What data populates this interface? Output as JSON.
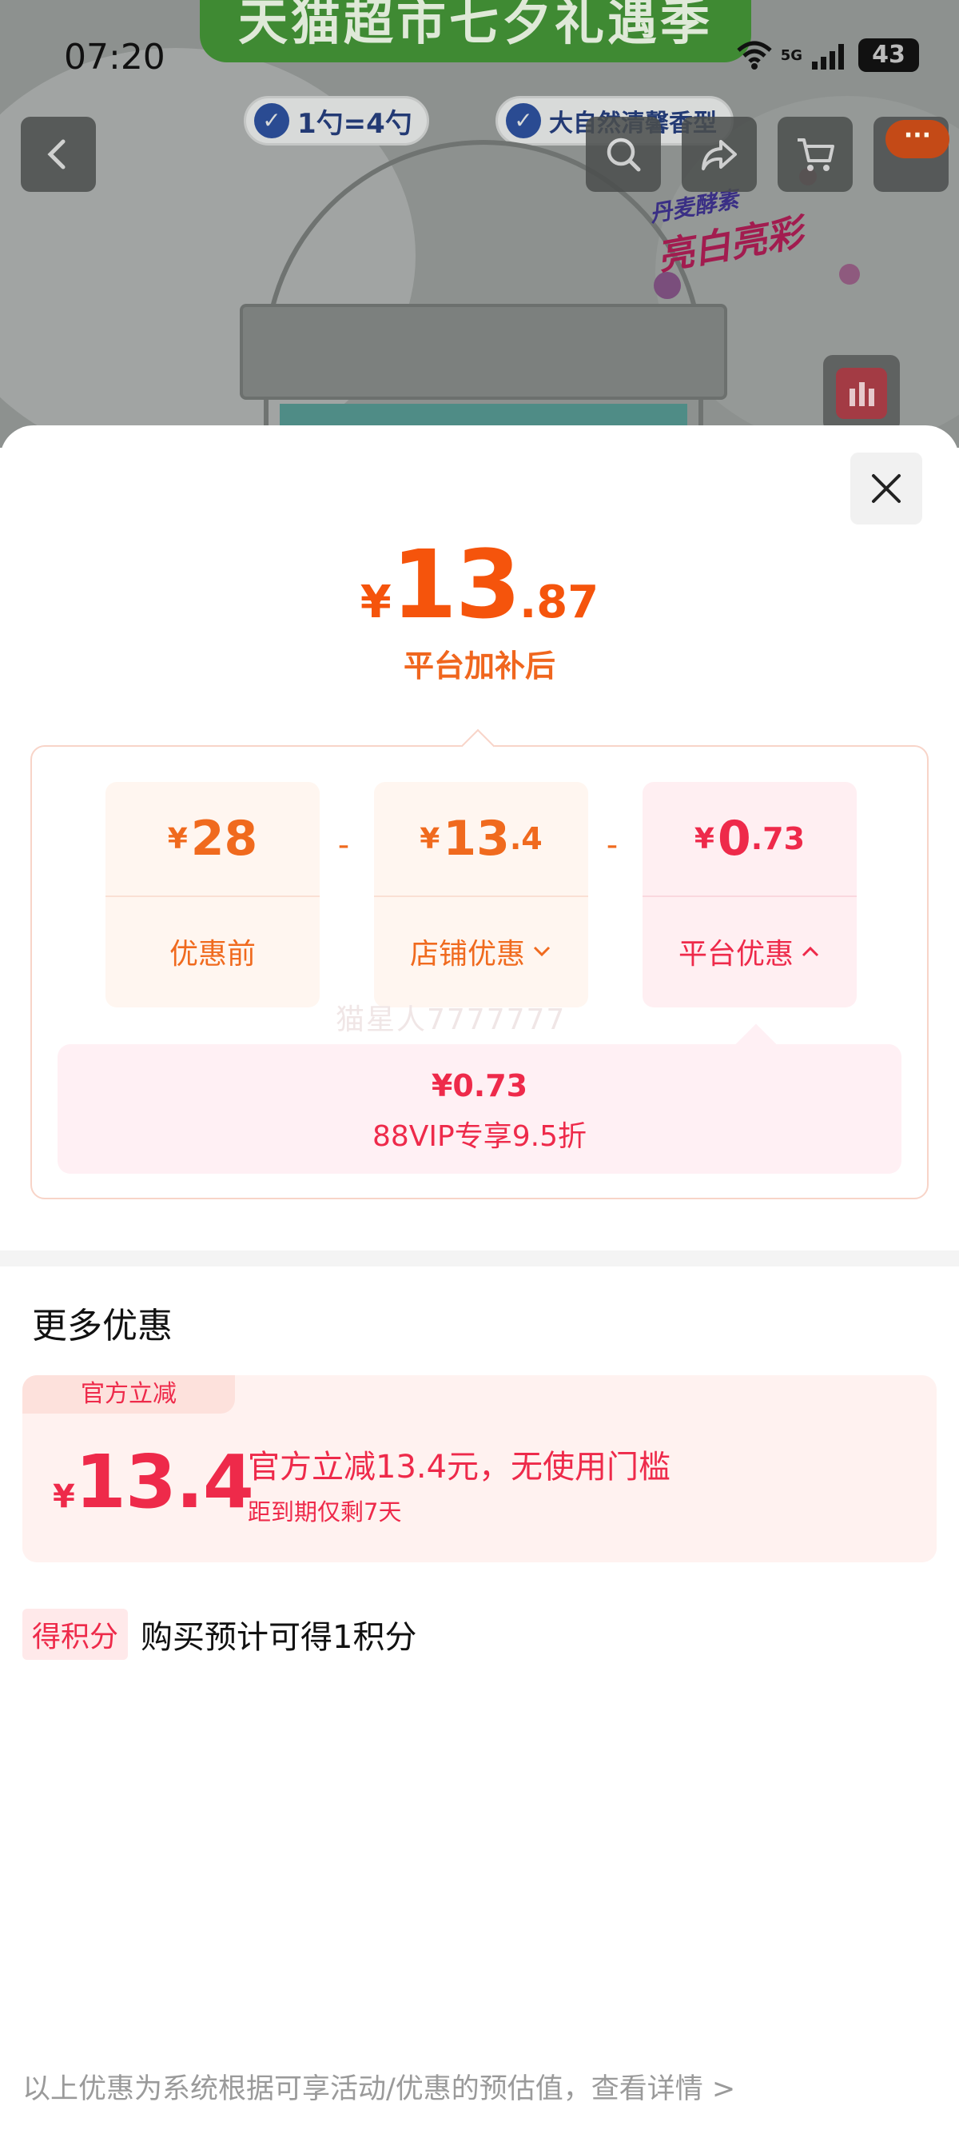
{
  "status_bar": {
    "time": "07:20",
    "network": "5G",
    "battery": "43"
  },
  "product_image": {
    "banner_text": "天猫超市七夕礼遇季",
    "chip_1": "1勺=4勺",
    "chip_2": "大自然清馨香型",
    "promo_line_1": "丹麦酵素",
    "promo_line_2": "亮白亮彩"
  },
  "nav": {
    "back_icon": "chevron-left-icon",
    "search_icon": "search-icon",
    "share_icon": "share-icon",
    "cart_icon": "cart-icon",
    "more_label": "···"
  },
  "sheet": {
    "final_price": {
      "currency": "¥",
      "integer": "13",
      "decimal": ".87",
      "caption": "平台加补后"
    },
    "breakdown": [
      {
        "currency": "¥",
        "integer": "28",
        "decimal": "",
        "label": "优惠前",
        "arrow": ""
      },
      {
        "currency": "¥",
        "integer": "13",
        "decimal": ".4",
        "label": "店铺优惠",
        "arrow": "down"
      },
      {
        "currency": "¥",
        "integer": "0",
        "decimal": ".73",
        "label": "平台优惠",
        "arrow": "up"
      }
    ],
    "operator": "-",
    "watermark": "猫星人7777777",
    "vip": {
      "amount": "¥0.73",
      "description": "88VIP专享9.5折"
    },
    "more_title": "更多优惠",
    "coupon": {
      "tag": "官方立减",
      "currency": "¥",
      "amount": "13.4",
      "description": "官方立减13.4元，无使用门槛",
      "expiry": "距到期仅剩7天"
    },
    "points": {
      "badge": "得积分",
      "text": "购买预计可得1积分"
    },
    "footer_note": "以上优惠为系统根据可享活动/优惠的预估值，查看详情 >"
  },
  "colors": {
    "orange": "#f5540c",
    "red": "#ee2a4a"
  }
}
